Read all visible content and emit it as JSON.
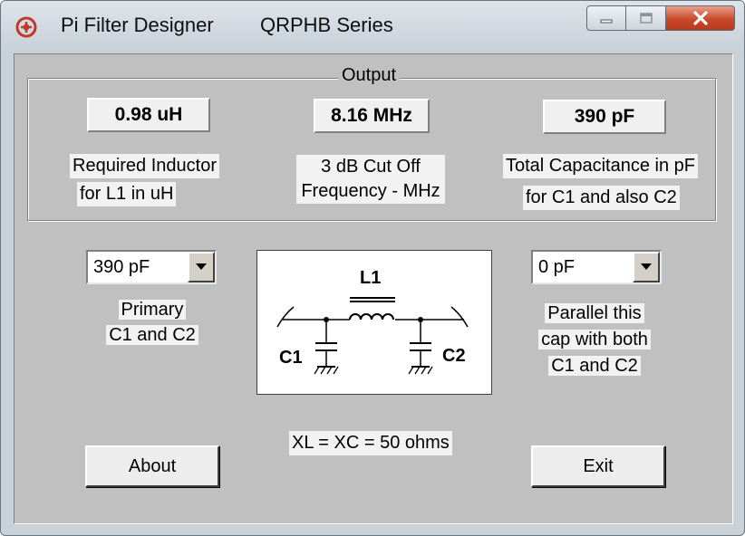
{
  "window": {
    "app_title": "Pi Filter Designer",
    "series_title": "QRPHB Series"
  },
  "output": {
    "group_title": "Output",
    "inductor_value": "0.98 uH",
    "inductor_label_line1": "Required  Inductor",
    "inductor_label_line2": "for  L1 in uH",
    "cutoff_value": "8.16 MHz",
    "cutoff_label_line1": "3 dB Cut Off",
    "cutoff_label_line2": "Frequency - MHz",
    "capacitance_value": "390 pF",
    "capacitance_label_line1": "Total Capacitance in pF",
    "capacitance_label_line2": "for C1 and also C2"
  },
  "primary": {
    "selected": "390 pF",
    "label_line1": "Primary",
    "label_line2": "C1 and C2"
  },
  "parallel": {
    "selected": "0 pF",
    "label_line1": "Parallel this",
    "label_line2": "cap with both",
    "label_line3": "C1 and C2"
  },
  "schematic": {
    "l1": "L1",
    "c1": "C1",
    "c2": "C2"
  },
  "impedance_text": "XL = XC = 50 ohms",
  "buttons": {
    "about": "About",
    "exit": "Exit"
  },
  "icons": {
    "app": "app-logo-icon",
    "minimize": "minimize-icon",
    "maximize": "maximize-icon",
    "close": "close-icon",
    "dropdown": "triangle-down-icon"
  },
  "colors": {
    "close_button": "#c94a2a",
    "app_icon": "#c0392b"
  }
}
